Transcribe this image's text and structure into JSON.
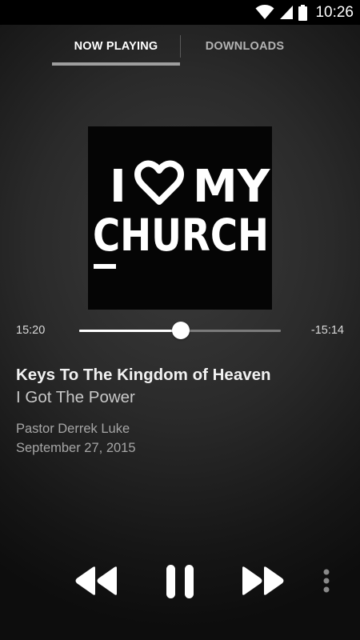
{
  "status_bar": {
    "time": "10:26",
    "icons": [
      "wifi-icon",
      "signal-icon",
      "battery-icon"
    ]
  },
  "tabs": [
    {
      "label": "NOW PLAYING",
      "active": true
    },
    {
      "label": "DOWNLOADS",
      "active": false
    }
  ],
  "album_art": {
    "line1": "I",
    "line1b": "MY",
    "line2": "CHURCH",
    "icon": "heart-icon"
  },
  "player": {
    "elapsed": "15:20",
    "remaining": "-15:14",
    "progress": 0.503
  },
  "track": {
    "title": "Keys To The Kingdom of Heaven",
    "subtitle": "I Got The Power",
    "speaker": "Pastor Derrek Luke",
    "date": "September 27, 2015"
  },
  "controls": {
    "rewind_icon": "rewind-icon",
    "pause_icon": "pause-icon",
    "forward_icon": "fast-forward-icon",
    "more_icon": "more-vertical-icon"
  },
  "colors": {
    "accent": "#ffffff",
    "tab_indicator": "#9e9e9e",
    "album_background": "#050505"
  }
}
